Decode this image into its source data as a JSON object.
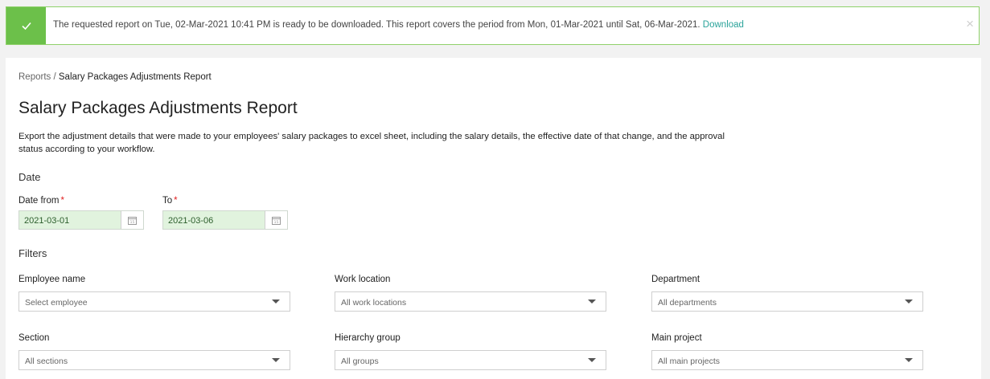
{
  "banner": {
    "message": "The requested report on Tue, 02-Mar-2021 10:41 PM is ready to be downloaded. This report covers the period from Mon, 01-Mar-2021 until Sat, 06-Mar-2021.",
    "link_label": "Download",
    "close_glyph": "×",
    "icon": "check-icon",
    "color": "#6cc04a"
  },
  "breadcrumb": {
    "parent": "Reports",
    "separator": "/",
    "current": "Salary Packages Adjustments Report"
  },
  "page": {
    "title": "Salary Packages Adjustments Report",
    "description": "Export the adjustment details that were made to your employees' salary packages to excel sheet, including the salary details, the effective date of that change, and the approval status according to your workflow."
  },
  "date_section": {
    "heading": "Date",
    "from_label": "Date from",
    "from_value": "2021-03-01",
    "to_label": "To",
    "to_value": "2021-03-06",
    "required_mark": "*"
  },
  "filters": {
    "heading": "Filters",
    "employee": {
      "label": "Employee name",
      "placeholder": "Select employee"
    },
    "work_location": {
      "label": "Work location",
      "placeholder": "All work locations"
    },
    "department": {
      "label": "Department",
      "placeholder": "All departments"
    },
    "section": {
      "label": "Section",
      "placeholder": "All sections"
    },
    "hierarchy_group": {
      "label": "Hierarchy group",
      "placeholder": "All groups"
    },
    "main_project": {
      "label": "Main project",
      "placeholder": "All main projects"
    }
  }
}
